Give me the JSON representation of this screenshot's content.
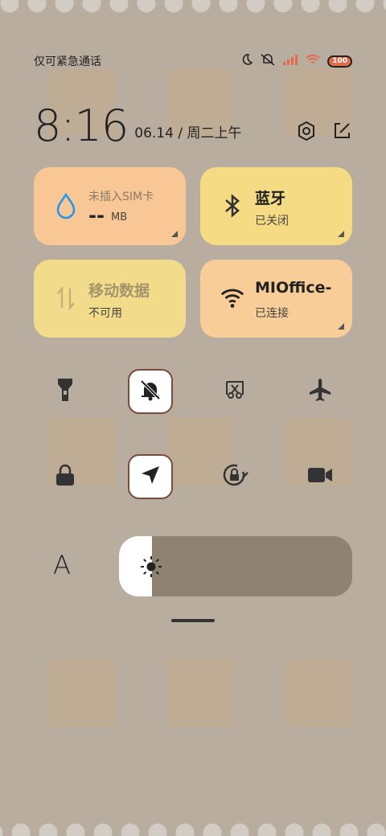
{
  "status_bar": {
    "carrier_text": "仅可紧急通话",
    "battery_level": "100",
    "icons": [
      "moon-icon",
      "mute-icon",
      "signal-icon",
      "wifi-icon",
      "battery-icon"
    ]
  },
  "clock": {
    "time": "8:16",
    "date": "06.14 / 周二上午"
  },
  "tiles": {
    "data_usage": {
      "title": "--",
      "unit": "MB",
      "sub": "未插入SIM卡"
    },
    "bluetooth": {
      "title": "蓝牙",
      "sub": "已关闭"
    },
    "mobile_data": {
      "title": "移动数据",
      "sub": "不可用"
    },
    "wifi": {
      "title": "MIOffice-",
      "sub": "已连接"
    }
  },
  "quick_toggles": {
    "row1": [
      "flashlight",
      "mute",
      "screenshot",
      "airplane-mode"
    ],
    "row2": [
      "lock-screen",
      "location",
      "rotation-lock",
      "screen-record"
    ]
  },
  "brightness": {
    "label": "A",
    "level": 0.14
  },
  "colors": {
    "tile_peach": "#f8c795",
    "tile_yellow": "#f5db84",
    "accent_blue": "#2196f3",
    "active_border": "#7a4a3a"
  }
}
